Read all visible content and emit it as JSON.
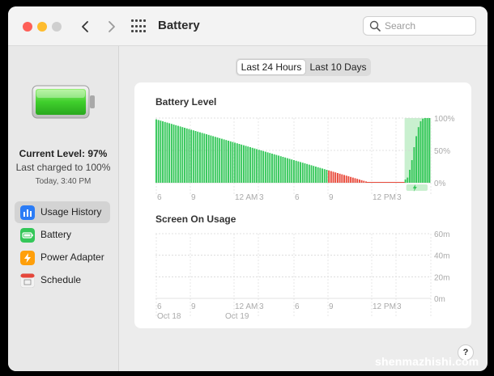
{
  "window": {
    "title": "Battery"
  },
  "search": {
    "placeholder": "Search"
  },
  "sidebar": {
    "current_level": "Current Level: 97%",
    "last_charged": "Last charged to 100%",
    "charged_time": "Today, 3:40 PM",
    "items": [
      {
        "label": "Usage History",
        "icon": "bar-chart-icon",
        "active": true
      },
      {
        "label": "Battery",
        "icon": "battery-icon",
        "active": false
      },
      {
        "label": "Power Adapter",
        "icon": "lightning-icon",
        "active": false
      },
      {
        "label": "Schedule",
        "icon": "calendar-icon",
        "active": false
      }
    ]
  },
  "tabs": [
    {
      "label": "Last 24 Hours",
      "selected": true
    },
    {
      "label": "Last 10 Days",
      "selected": false
    }
  ],
  "watermark": "shenmazhishi.com",
  "help_label": "?",
  "colors": {
    "battery_green": "#34c759",
    "low_red": "#e94b3c",
    "charging_band": "#c9f0cf"
  },
  "chart_data": [
    {
      "type": "bar",
      "title": "Battery Level",
      "x_ticks": [
        "6",
        "9",
        "12 AM",
        "3",
        "6",
        "9",
        "12 PM",
        "3"
      ],
      "y_ticks": [
        "100%",
        "50%",
        "0%"
      ],
      "ylim": [
        0,
        100
      ],
      "values": [
        98,
        97,
        96,
        95,
        94,
        93,
        92,
        91,
        90,
        89,
        88,
        87,
        86,
        85,
        84,
        83,
        82,
        81,
        80,
        79,
        78,
        77,
        76,
        75,
        74,
        73,
        72,
        71,
        70,
        69,
        68,
        67,
        66,
        65,
        64,
        63,
        62,
        61,
        60,
        59,
        58,
        57,
        56,
        55,
        54,
        53,
        52,
        51,
        50,
        49,
        48,
        47,
        46,
        45,
        44,
        43,
        42,
        41,
        40,
        39,
        38,
        37,
        36,
        35,
        34,
        33,
        32,
        31,
        30,
        29,
        28,
        27,
        26,
        25,
        24,
        23,
        22,
        21,
        20,
        19,
        18,
        17,
        16,
        15,
        14,
        13,
        12,
        11,
        10,
        9,
        8,
        7,
        6,
        5,
        4,
        3,
        2,
        1,
        0,
        0,
        0,
        0,
        0,
        0,
        0,
        0,
        0,
        0,
        0,
        0,
        0,
        0,
        0,
        0,
        5,
        8,
        20,
        35,
        55,
        72,
        86,
        95,
        99,
        100,
        100,
        100
      ],
      "low_threshold": 20,
      "charging_period_start_index": 114
    },
    {
      "type": "bar",
      "title": "Screen On Usage",
      "x_ticks": [
        "6",
        "9",
        "12 AM",
        "3",
        "6",
        "9",
        "12 PM",
        "3"
      ],
      "y_ticks": [
        "60m",
        "40m",
        "20m",
        "0m"
      ],
      "date_labels": [
        "Oct 18",
        "Oct 19"
      ],
      "ylim": [
        0,
        60
      ],
      "values": []
    }
  ]
}
